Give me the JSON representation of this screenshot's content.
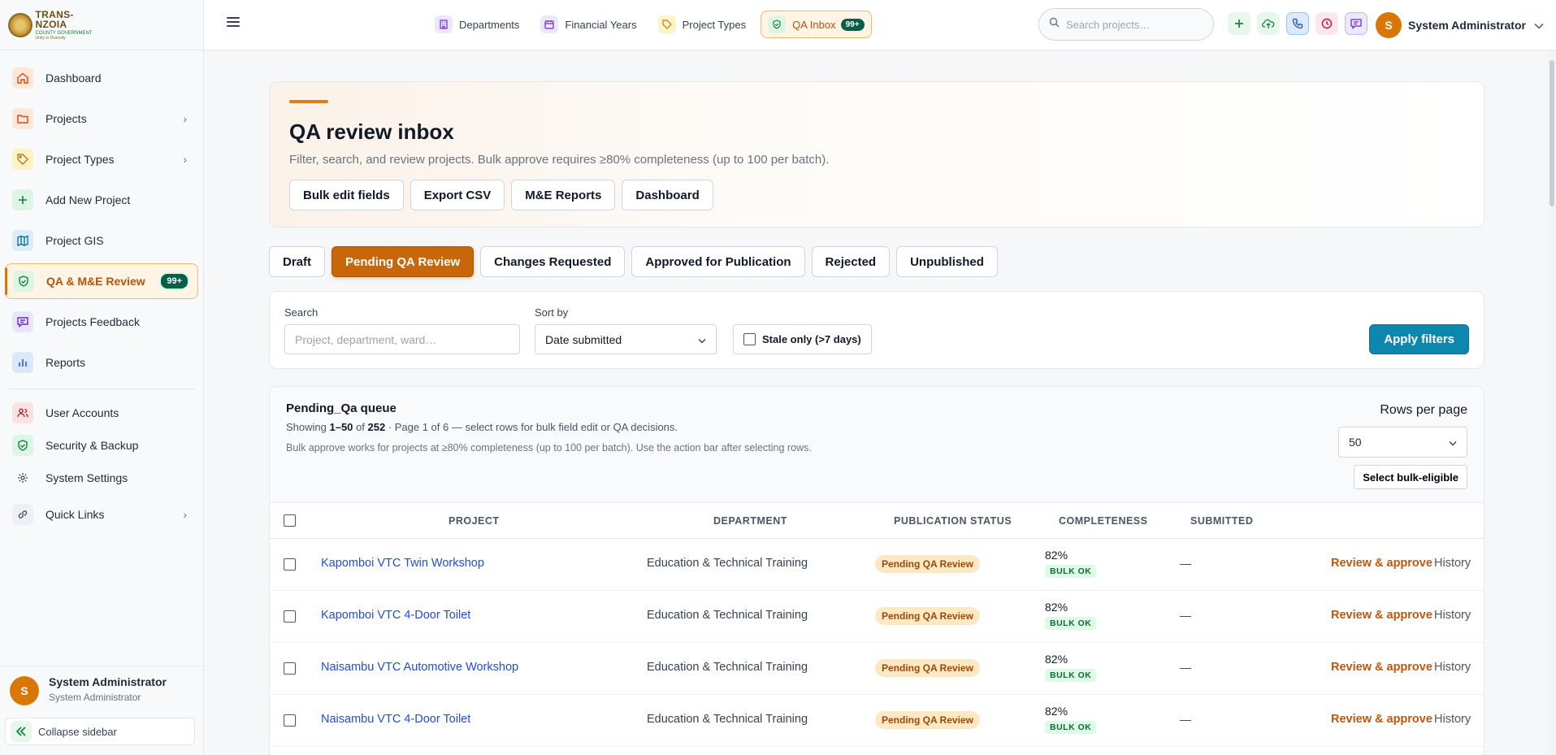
{
  "logo": {
    "title": "TRANS-NZOIA",
    "subtitle": "COUNTY GOVERNMENT",
    "motto": "Unity in Diversity"
  },
  "sidebar": {
    "items": [
      {
        "label": "Dashboard"
      },
      {
        "label": "Projects"
      },
      {
        "label": "Project Types"
      },
      {
        "label": "Add New Project"
      },
      {
        "label": "Project GIS"
      },
      {
        "label": "QA & M&E Review",
        "badge": "99+"
      },
      {
        "label": "Projects Feedback"
      },
      {
        "label": "Reports"
      },
      {
        "label": "User Accounts"
      },
      {
        "label": "Security & Backup"
      },
      {
        "label": "System Settings"
      },
      {
        "label": "Quick Links"
      }
    ],
    "user": {
      "initial": "S",
      "name": "System Administrator",
      "role": "System Administrator"
    },
    "collapse_label": "Collapse sidebar"
  },
  "topbar": {
    "quick_links": [
      {
        "label": "Departments"
      },
      {
        "label": "Financial Years"
      },
      {
        "label": "Project Types"
      },
      {
        "label": "QA Inbox",
        "badge": "99+"
      }
    ],
    "search_placeholder": "Search projects…",
    "user": {
      "initial": "S",
      "name": "System Administrator"
    }
  },
  "hero": {
    "title": "QA review inbox",
    "description": "Filter, search, and review projects. Bulk approve requires ≥80% completeness (up to 100 per batch).",
    "actions": [
      "Bulk edit fields",
      "Export CSV",
      "M&E Reports",
      "Dashboard"
    ]
  },
  "tabs": [
    "Draft",
    "Pending QA Review",
    "Changes Requested",
    "Approved for Publication",
    "Rejected",
    "Unpublished"
  ],
  "filters": {
    "search_label": "Search",
    "search_placeholder": "Project, department, ward…",
    "sort_label": "Sort by",
    "sort_value": "Date submitted",
    "stale_label": "Stale only (>7 days)",
    "apply_label": "Apply filters"
  },
  "queue": {
    "title": "Pending_Qa queue",
    "showing_prefix": "Showing ",
    "showing_range": "1–50",
    "showing_of": " of ",
    "showing_total": "252",
    "showing_suffix": " · Page 1 of 6 — select rows for bulk field edit or QA decisions.",
    "note": "Bulk approve works for projects at ≥80% completeness (up to 100 per batch). Use the action bar after selecting rows.",
    "rows_per_page_label": "Rows per page",
    "rows_per_page": "50",
    "select_bulk_label": "Select bulk-eligible",
    "columns": [
      "PROJECT",
      "DEPARTMENT",
      "PUBLICATION STATUS",
      "COMPLETENESS",
      "SUBMITTED"
    ],
    "rows": [
      {
        "project": "Kapomboi VTC Twin Workshop",
        "department": "Education & Technical Training",
        "status": "Pending QA Review",
        "completeness": "82%",
        "bulk": "BULK OK",
        "submitted": "—",
        "review": "Review & approve",
        "history": "History"
      },
      {
        "project": "Kapomboi VTC 4-Door Toilet",
        "department": "Education & Technical Training",
        "status": "Pending QA Review",
        "completeness": "82%",
        "bulk": "BULK OK",
        "submitted": "—",
        "review": "Review & approve",
        "history": "History"
      },
      {
        "project": "Naisambu VTC Automotive Workshop",
        "department": "Education & Technical Training",
        "status": "Pending QA Review",
        "completeness": "82%",
        "bulk": "BULK OK",
        "submitted": "—",
        "review": "Review & approve",
        "history": "History"
      },
      {
        "project": "Naisambu VTC 4-Door Toilet",
        "department": "Education & Technical Training",
        "status": "Pending QA Review",
        "completeness": "82%",
        "bulk": "BULK OK",
        "submitted": "—",
        "review": "Review & approve",
        "history": "History"
      }
    ]
  },
  "colors": {
    "accent": "#c8660a",
    "primary": "#0e87ae",
    "link": "#1d4ed8",
    "badge": "#065f46"
  }
}
